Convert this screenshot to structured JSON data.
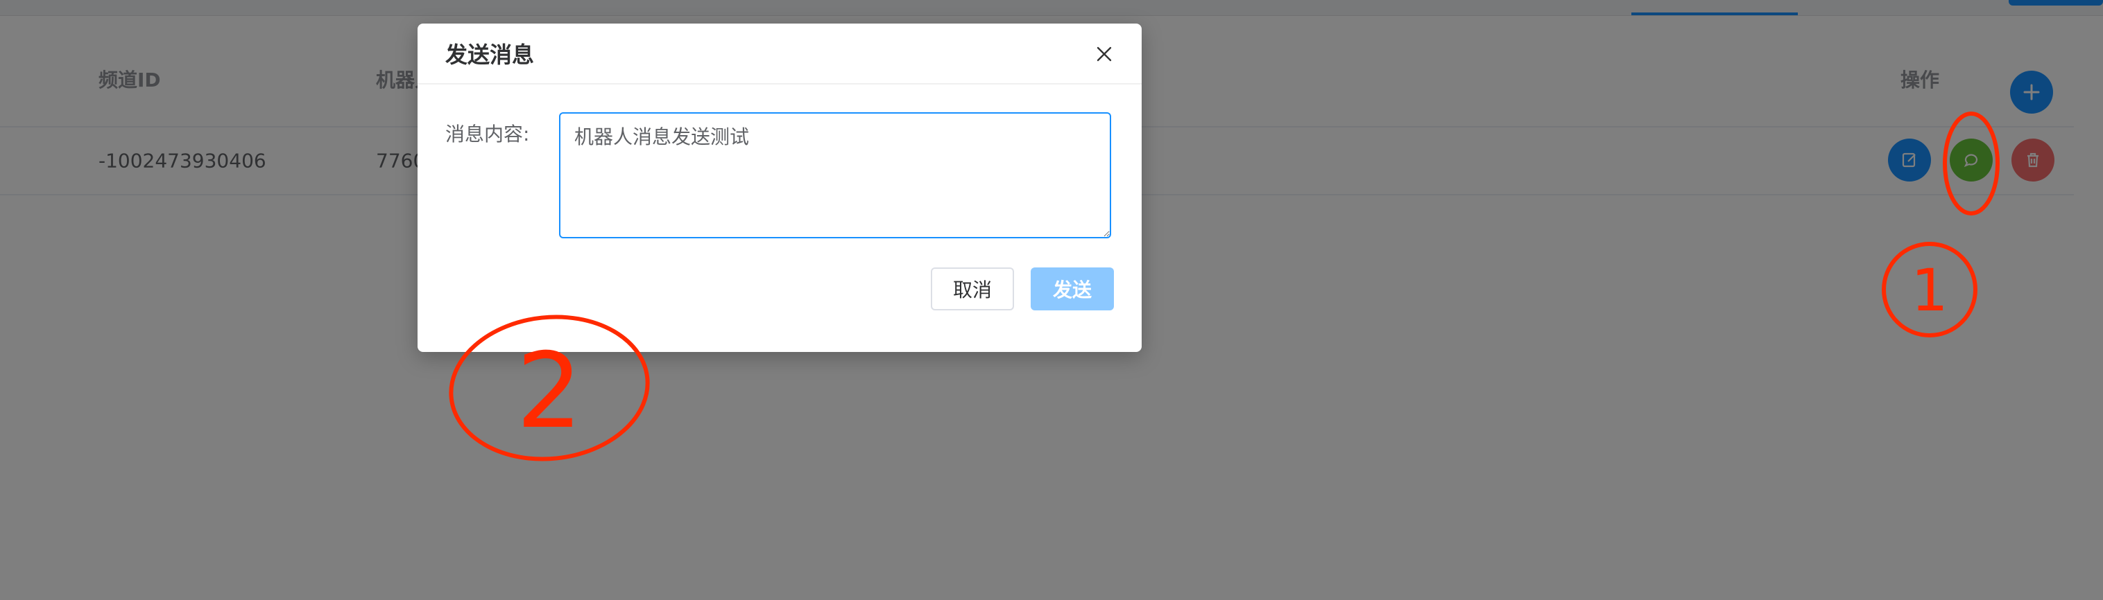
{
  "table": {
    "headers": {
      "channel_id": "频道ID",
      "bot": "机器人",
      "actions": "操作"
    },
    "rows": [
      {
        "channel_id": "-1002473930406",
        "bot_prefix": "7760"
      }
    ]
  },
  "dialog": {
    "title": "发送消息",
    "field_label": "消息内容:",
    "message_value": "机器人消息发送测试",
    "cancel_label": "取消",
    "send_label": "发送"
  },
  "annotations": {
    "mark_1": "1",
    "mark_2": "2",
    "color": "#ff2a00"
  },
  "colors": {
    "primary": "#1890ff",
    "success": "#67c23a",
    "danger": "#f56c6c",
    "send_disabled": "#8cc8ff"
  },
  "icons": {
    "add": "plus-icon",
    "edit": "edit-icon",
    "message": "chat-icon",
    "delete": "trash-icon",
    "close": "close-icon"
  }
}
